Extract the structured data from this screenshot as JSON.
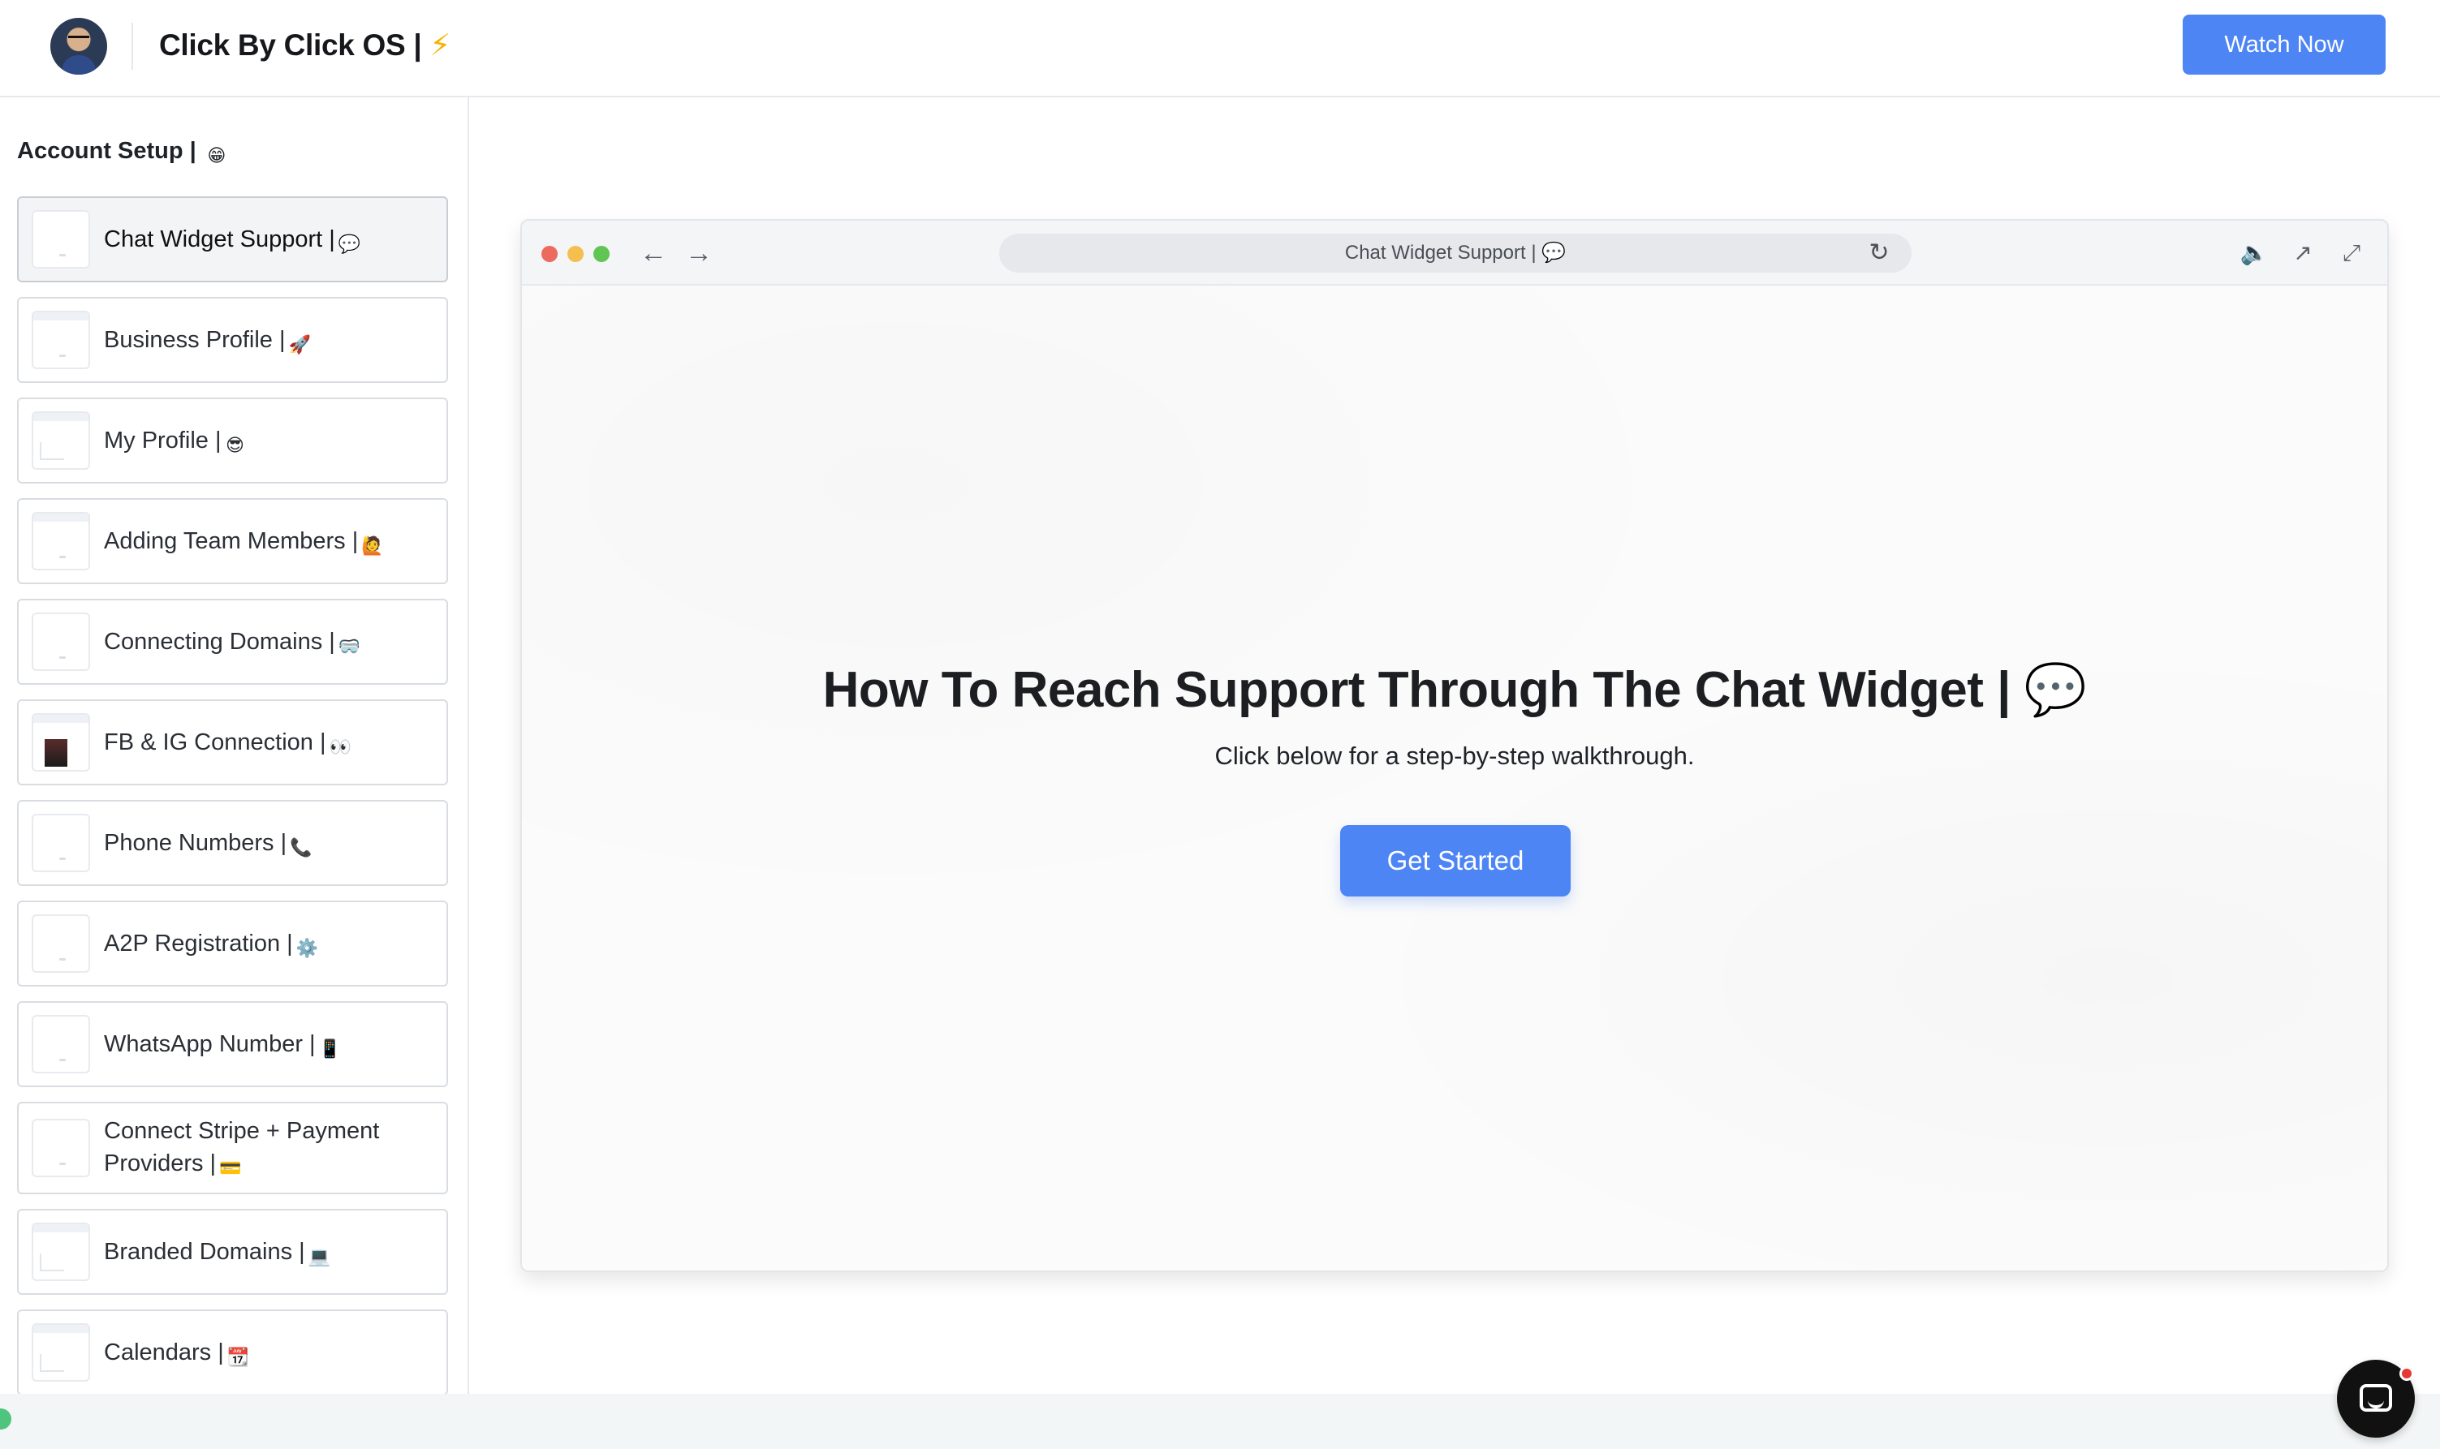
{
  "header": {
    "title": "Click By Click OS |",
    "title_emoji": "⚡",
    "watch_button": "Watch Now"
  },
  "sidebar": {
    "section_title": "Account Setup |",
    "section_emoji": "😁",
    "items": [
      {
        "label": "Chat Widget Support |",
        "emoji": "💬",
        "active": true
      },
      {
        "label": "Business Profile |",
        "emoji": "🚀"
      },
      {
        "label": "My Profile |",
        "emoji": "😎"
      },
      {
        "label": "Adding Team Members |",
        "emoji": "🙋"
      },
      {
        "label": "Connecting Domains |",
        "emoji": "🥽"
      },
      {
        "label": "FB & IG Connection |",
        "emoji": "👀"
      },
      {
        "label": "Phone Numbers |",
        "emoji": "📞"
      },
      {
        "label": "A2P Registration |",
        "emoji": "⚙️"
      },
      {
        "label": "WhatsApp Number |",
        "emoji": "📱"
      },
      {
        "label_line1": "Connect Stripe + Payment",
        "label_line2": "Providers |",
        "emoji": "💳"
      },
      {
        "label": "Branded Domains |",
        "emoji": "💻"
      },
      {
        "label": "Calendars |",
        "emoji": "📆"
      }
    ]
  },
  "browser": {
    "url_text": "Chat Widget Support |",
    "url_emoji": "💬",
    "icons": {
      "back": "arrow-left-icon",
      "forward": "arrow-right-icon",
      "reload": "reload-icon",
      "sound": "speaker-icon",
      "open": "external-link-icon",
      "fullscreen": "expand-icon"
    }
  },
  "main": {
    "headline": "How To Reach Support Through The Chat Widget |",
    "headline_emoji": "💬",
    "subhead": "Click below for a step-by-step walkthrough.",
    "cta": "Get Started"
  },
  "colors": {
    "accent": "#4d85f5",
    "border": "#d9dde2",
    "launcher": "#111111",
    "badge": "#e53935"
  }
}
